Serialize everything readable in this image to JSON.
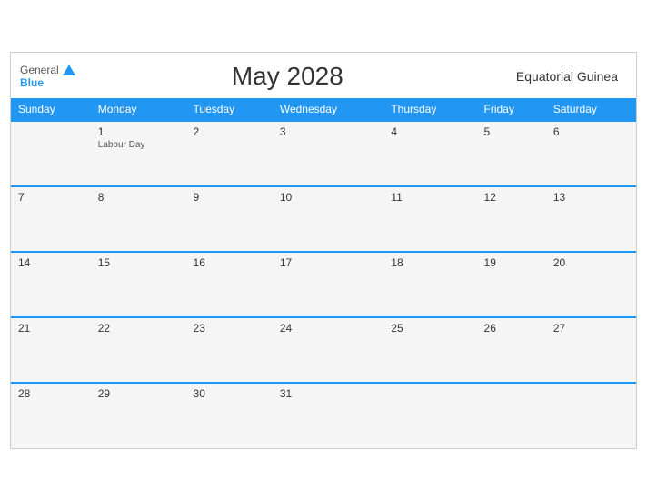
{
  "header": {
    "logo_general": "General",
    "logo_blue": "Blue",
    "month_title": "May 2028",
    "country": "Equatorial Guinea"
  },
  "weekdays": [
    "Sunday",
    "Monday",
    "Tuesday",
    "Wednesday",
    "Thursday",
    "Friday",
    "Saturday"
  ],
  "weeks": [
    [
      {
        "day": "",
        "empty": true
      },
      {
        "day": "1",
        "holiday": "Labour Day"
      },
      {
        "day": "2"
      },
      {
        "day": "3"
      },
      {
        "day": "4"
      },
      {
        "day": "5"
      },
      {
        "day": "6"
      }
    ],
    [
      {
        "day": "7"
      },
      {
        "day": "8"
      },
      {
        "day": "9"
      },
      {
        "day": "10"
      },
      {
        "day": "11"
      },
      {
        "day": "12"
      },
      {
        "day": "13"
      }
    ],
    [
      {
        "day": "14"
      },
      {
        "day": "15"
      },
      {
        "day": "16"
      },
      {
        "day": "17"
      },
      {
        "day": "18"
      },
      {
        "day": "19"
      },
      {
        "day": "20"
      }
    ],
    [
      {
        "day": "21"
      },
      {
        "day": "22"
      },
      {
        "day": "23"
      },
      {
        "day": "24"
      },
      {
        "day": "25"
      },
      {
        "day": "26"
      },
      {
        "day": "27"
      }
    ],
    [
      {
        "day": "28"
      },
      {
        "day": "29"
      },
      {
        "day": "30"
      },
      {
        "day": "31"
      },
      {
        "day": "",
        "empty": true
      },
      {
        "day": "",
        "empty": true
      },
      {
        "day": "",
        "empty": true
      }
    ]
  ]
}
